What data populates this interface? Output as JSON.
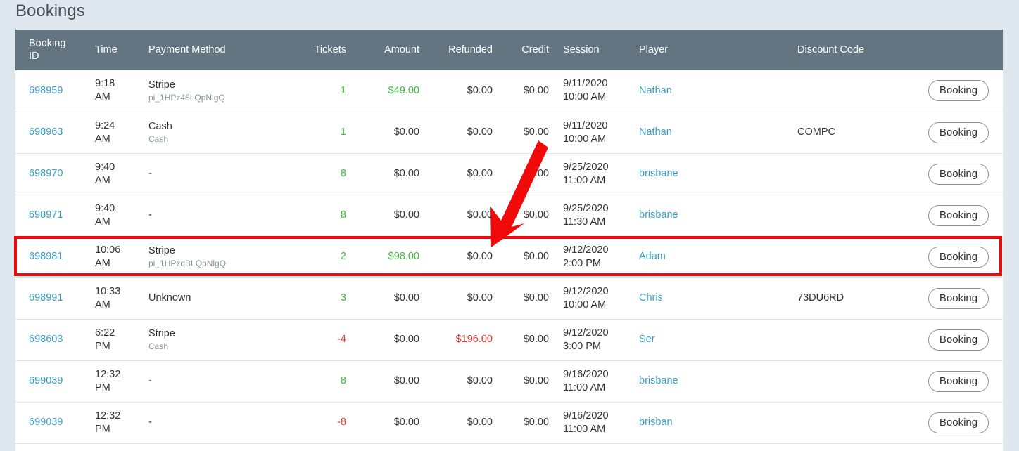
{
  "page": {
    "title": "Bookings"
  },
  "table": {
    "headers": {
      "booking_id": "Booking ID",
      "time": "Time",
      "payment_method": "Payment Method",
      "tickets": "Tickets",
      "amount": "Amount",
      "refunded": "Refunded",
      "credit": "Credit",
      "session": "Session",
      "player": "Player",
      "discount_code": "Discount Code"
    },
    "button_label": "Booking",
    "rows": [
      {
        "id": "698959",
        "time1": "9:18",
        "time2": "AM",
        "method": "Stripe",
        "method_sub": "pi_1HPz45LQpNlgQ",
        "tickets": "1",
        "amount": "$49.00",
        "refunded": "$0.00",
        "credit": "$0.00",
        "session1": "9/11/2020",
        "session2": "10:00 AM",
        "player": "Nathan",
        "discount": ""
      },
      {
        "id": "698963",
        "time1": "9:24",
        "time2": "AM",
        "method": "Cash",
        "method_sub": "Cash",
        "tickets": "1",
        "amount": "$0.00",
        "refunded": "$0.00",
        "credit": "$0.00",
        "session1": "9/11/2020",
        "session2": "10:00 AM",
        "player": "Nathan",
        "discount": "COMPC"
      },
      {
        "id": "698970",
        "time1": "9:40",
        "time2": "AM",
        "method": "-",
        "method_sub": "",
        "tickets": "8",
        "amount": "$0.00",
        "refunded": "$0.00",
        "credit": "$0.00",
        "session1": "9/25/2020",
        "session2": "11:00 AM",
        "player": "brisbane",
        "discount": ""
      },
      {
        "id": "698971",
        "time1": "9:40",
        "time2": "AM",
        "method": "-",
        "method_sub": "",
        "tickets": "8",
        "amount": "$0.00",
        "refunded": "$0.00",
        "credit": "$0.00",
        "session1": "9/25/2020",
        "session2": "11:30 AM",
        "player": "brisbane",
        "discount": ""
      },
      {
        "id": "698981",
        "time1": "10:06",
        "time2": "AM",
        "method": "Stripe",
        "method_sub": "pi_1HPzqBLQpNlgQ",
        "tickets": "2",
        "amount": "$98.00",
        "refunded": "$0.00",
        "credit": "$0.00",
        "session1": "9/12/2020",
        "session2": "2:00 PM",
        "player": "Adam",
        "discount": ""
      },
      {
        "id": "698991",
        "time1": "10:33",
        "time2": "AM",
        "method": "Unknown",
        "method_sub": "",
        "tickets": "3",
        "amount": "$0.00",
        "refunded": "$0.00",
        "credit": "$0.00",
        "session1": "9/12/2020",
        "session2": "10:00 AM",
        "player": "Chris",
        "discount": "73DU6RD"
      },
      {
        "id": "698603",
        "time1": "6:22",
        "time2": "PM",
        "method": "Stripe",
        "method_sub": "Cash",
        "tickets": "-4",
        "amount": "$0.00",
        "refunded": "$196.00",
        "credit": "$0.00",
        "session1": "9/12/2020",
        "session2": "3:00 PM",
        "player": "Ser",
        "discount": ""
      },
      {
        "id": "699039",
        "time1": "12:32",
        "time2": "PM",
        "method": "-",
        "method_sub": "",
        "tickets": "8",
        "amount": "$0.00",
        "refunded": "$0.00",
        "credit": "$0.00",
        "session1": "9/16/2020",
        "session2": "11:00 AM",
        "player": "brisbane",
        "discount": ""
      },
      {
        "id": "699039",
        "time1": "12:32",
        "time2": "PM",
        "method": "-",
        "method_sub": "",
        "tickets": "-8",
        "amount": "$0.00",
        "refunded": "$0.00",
        "credit": "$0.00",
        "session1": "9/16/2020",
        "session2": "11:00 AM",
        "player": "brisban",
        "discount": ""
      }
    ]
  },
  "colors": {
    "header_bg": "#647582",
    "link": "#3a9dc8",
    "positive": "#3fb53f",
    "negative": "#e8322a",
    "annotation": "#f00a0a"
  }
}
